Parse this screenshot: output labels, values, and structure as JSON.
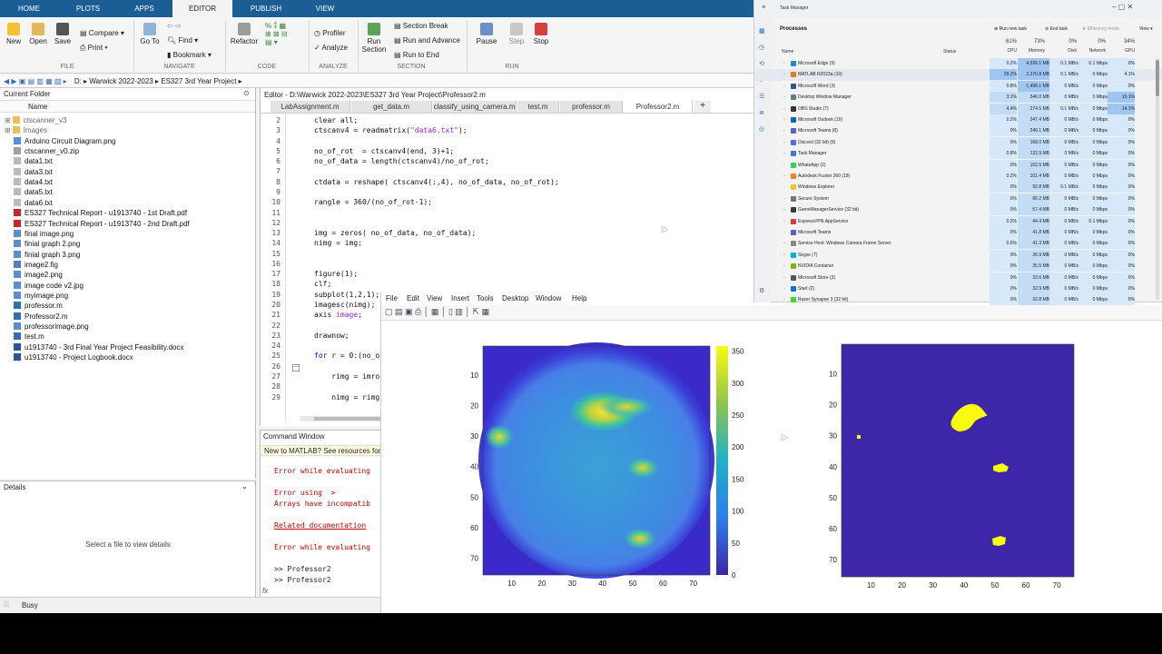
{
  "tabs": {
    "home": "HOME",
    "plots": "PLOTS",
    "apps": "APPS",
    "editor": "EDITOR",
    "publish": "PUBLISH",
    "view": "VIEW"
  },
  "ribbon": {
    "new": "New",
    "open": "Open",
    "save": "Save",
    "compare": "Compare",
    "print": "Print",
    "goto": "Go To",
    "find": "Find",
    "bookmark": "Bookmark",
    "refactor": "Refactor",
    "profiler": "Profiler",
    "analyze": "Analyze",
    "run_section": "Run Section",
    "section_break": "Section Break",
    "run_and_advance": "Run and Advance",
    "run_to_end": "Run to End",
    "pause": "Pause",
    "step": "Step",
    "stop": "Stop",
    "groups": {
      "file": "FILE",
      "navigate": "NAVIGATE",
      "code": "CODE",
      "analyze": "ANALYZE",
      "section": "SECTION",
      "run": "RUN"
    }
  },
  "address": {
    "root": "D:",
    "p1": "Warwick 2022-2023",
    "p2": "ES327 3rd Year Project"
  },
  "current_folder": {
    "title": "Current Folder",
    "name_col": "Name",
    "items": [
      {
        "label": "ctscanner_v3",
        "type": "folder"
      },
      {
        "label": "Images",
        "type": "folder"
      },
      {
        "label": "Arduino Circuit Diagram.png",
        "type": "png"
      },
      {
        "label": "ctscanner_v0.zip",
        "type": "zip"
      },
      {
        "label": "data1.txt",
        "type": "txt"
      },
      {
        "label": "data3.txt",
        "type": "txt"
      },
      {
        "label": "data4.txt",
        "type": "txt"
      },
      {
        "label": "data5.txt",
        "type": "txt"
      },
      {
        "label": "data6.txt",
        "type": "txt"
      },
      {
        "label": "ES327 Technical Report - u1913740 - 1st Draft.pdf",
        "type": "pdf"
      },
      {
        "label": "ES327 Technical Report - u1913740 - 2nd Draft.pdf",
        "type": "pdf"
      },
      {
        "label": "final image.png",
        "type": "png"
      },
      {
        "label": "finial graph 2.png",
        "type": "png"
      },
      {
        "label": "finial graph 3.png",
        "type": "png"
      },
      {
        "label": "image2.fig",
        "type": "fig"
      },
      {
        "label": "image2.png",
        "type": "png"
      },
      {
        "label": "image code v2.jpg",
        "type": "png"
      },
      {
        "label": "myimage.png",
        "type": "png"
      },
      {
        "label": "professor.m",
        "type": "m"
      },
      {
        "label": "Professor2.m",
        "type": "m"
      },
      {
        "label": "professorimage.png",
        "type": "png"
      },
      {
        "label": "test.m",
        "type": "m"
      },
      {
        "label": "u1913740 - 3rd Final Year Project Feasibility.docx",
        "type": "docx"
      },
      {
        "label": "u1913740 - Project Logbook.docx",
        "type": "docx"
      }
    ]
  },
  "details": {
    "title": "Details",
    "empty_msg": "Select a file to view details"
  },
  "editor": {
    "title": "Editor - D:\\Warwick 2022-2023\\ES327 3rd Year Project\\Professor2.m",
    "tabs": [
      "LabAssignment.m",
      "get_data.m",
      "classify_using_camera.m",
      "test.m",
      "professor.m",
      "Professor2.m"
    ],
    "lines": [
      {
        "n": "2",
        "t": "clear all;"
      },
      {
        "n": "3",
        "t": "ctscanv4 = readmatrix(",
        "s": "\"data6.txt\"",
        "e": ");"
      },
      {
        "n": "4",
        "t": ""
      },
      {
        "n": "5",
        "t": "no_of_rot  = ctscanv4(end, 3)+1;"
      },
      {
        "n": "6",
        "t": "no_of_data = length(ctscanv4)/no_of_rot;"
      },
      {
        "n": "7",
        "t": ""
      },
      {
        "n": "8",
        "t": "ctdata = reshape( ctscanv4(:,4), no_of_data, no_of_rot);"
      },
      {
        "n": "9",
        "t": ""
      },
      {
        "n": "10",
        "t": "rangle = 360/(no_of_rot-1);"
      },
      {
        "n": "11",
        "t": ""
      },
      {
        "n": "12",
        "t": ""
      },
      {
        "n": "13",
        "t": "img = zeros( no_of_data, no_of_data);"
      },
      {
        "n": "14",
        "t": "nimg = img;"
      },
      {
        "n": "15",
        "t": ""
      },
      {
        "n": "16",
        "t": ""
      },
      {
        "n": "17",
        "t": "figure(1);"
      },
      {
        "n": "18",
        "t": "clf;"
      },
      {
        "n": "19",
        "t": "subplot(1,2,1);"
      },
      {
        "n": "20",
        "t": "imagesc(nimg);"
      },
      {
        "n": "21",
        "t": "axis ",
        "s": "image",
        "e": ";"
      },
      {
        "n": "22",
        "t": ""
      },
      {
        "n": "23",
        "t": "drawnow;"
      },
      {
        "n": "24",
        "t": ""
      },
      {
        "n": "25",
        "k": "for",
        "t": " r = 0:(no_o"
      },
      {
        "n": "26",
        "t": ""
      },
      {
        "n": "27",
        "t": "    rimg = imro"
      },
      {
        "n": "28",
        "t": ""
      },
      {
        "n": "29",
        "t": "    nimg = rimg"
      }
    ]
  },
  "command_window": {
    "title": "Command Window",
    "banner": "New to MATLAB? See resources for G",
    "lines": [
      "Error while evaluating",
      "",
      "Error using  >",
      "Arrays have incompatib",
      "",
      "Related documentation",
      "",
      "Error while evaluating",
      "",
      ">> Professor2",
      ">> Professor2"
    ],
    "prompt": "fx"
  },
  "status": {
    "busy": "Busy"
  },
  "figure": {
    "menu": [
      "File",
      "Edit",
      "View",
      "Insert",
      "Tools",
      "Desktop",
      "Window",
      "Help"
    ],
    "left_axis_ticks_y": [
      "10",
      "20",
      "30",
      "40",
      "50",
      "60",
      "70"
    ],
    "left_axis_ticks_x": [
      "10",
      "20",
      "30",
      "40",
      "50",
      "60",
      "70"
    ],
    "colorbar_ticks": [
      "350",
      "300",
      "250",
      "200",
      "150",
      "100",
      "50",
      "0"
    ],
    "right_axis_ticks_y": [
      "10",
      "20",
      "30",
      "40",
      "50",
      "60",
      "70"
    ],
    "right_axis_ticks_x": [
      "10",
      "20",
      "30",
      "40",
      "50",
      "60",
      "70"
    ]
  },
  "taskmgr": {
    "title": "Task Manager",
    "toolbar": {
      "run_new": "Run new task",
      "end_task": "End task",
      "efficiency": "Efficiency mode",
      "view": "View"
    },
    "heading": "Processes",
    "cols": {
      "name": "Name",
      "status": "Status",
      "cpu": "CPU",
      "memory": "Memory",
      "disk": "Disk",
      "network": "Network",
      "gpu": "GPU"
    },
    "totals": {
      "cpu": "61%",
      "memory": "73%",
      "disk": "0%",
      "network": "0%",
      "gpu": "34%"
    },
    "rows": [
      {
        "name": "Microsoft Edge (9)",
        "cpu": "0.2%",
        "mem": "4,026.1 MB",
        "disk": "0.1 MB/s",
        "net": "0.1 Mbps",
        "gpu": "0%"
      },
      {
        "name": "MATLAB R2023a (10)",
        "cpu": "29.2%",
        "mem": "2,270.8 MB",
        "disk": "0.1 MB/s",
        "net": "0 Mbps",
        "gpu": "4.1%"
      },
      {
        "name": "Microsoft Word (3)",
        "cpu": "0.8%",
        "mem": "1,498.1 MB",
        "disk": "0 MB/s",
        "net": "0 Mbps",
        "gpu": "0%"
      },
      {
        "name": "Desktop Window Manager",
        "cpu": "3.1%",
        "mem": "346.0 MB",
        "disk": "0 MB/s",
        "net": "0 Mbps",
        "gpu": "10.1%"
      },
      {
        "name": "OBS Studio (7)",
        "cpu": "4.4%",
        "mem": "274.5 MB",
        "disk": "0.1 MB/s",
        "net": "0 Mbps",
        "gpu": "14.1%"
      },
      {
        "name": "Microsoft Outlook (10)",
        "cpu": "0.2%",
        "mem": "247.4 MB",
        "disk": "0 MB/s",
        "net": "0 Mbps",
        "gpu": "0%"
      },
      {
        "name": "Microsoft Teams (8)",
        "cpu": "0%",
        "mem": "240.1 MB",
        "disk": "0 MB/s",
        "net": "0 Mbps",
        "gpu": "0%"
      },
      {
        "name": "Discord (32 bit) (8)",
        "cpu": "0%",
        "mem": "168.0 MB",
        "disk": "0 MB/s",
        "net": "0 Mbps",
        "gpu": "0%"
      },
      {
        "name": "Task Manager",
        "cpu": "0.8%",
        "mem": "132.9 MB",
        "disk": "0 MB/s",
        "net": "0 Mbps",
        "gpu": "0%"
      },
      {
        "name": "WhatsApp (2)",
        "cpu": "0%",
        "mem": "102.5 MB",
        "disk": "0 MB/s",
        "net": "0 Mbps",
        "gpu": "0%"
      },
      {
        "name": "Autodesk Fusion 360 (18)",
        "cpu": "0.2%",
        "mem": "101.4 MB",
        "disk": "0 MB/s",
        "net": "0 Mbps",
        "gpu": "0%"
      },
      {
        "name": "Windows Explorer",
        "cpu": "0%",
        "mem": "92.8 MB",
        "disk": "0.1 MB/s",
        "net": "0 Mbps",
        "gpu": "0%"
      },
      {
        "name": "Secure System",
        "cpu": "0%",
        "mem": "80.2 MB",
        "disk": "0 MB/s",
        "net": "0 Mbps",
        "gpu": "0%"
      },
      {
        "name": "GameManagerService (32 bit)",
        "cpu": "0%",
        "mem": "57.4 MB",
        "disk": "0 MB/s",
        "net": "0 Mbps",
        "gpu": "0%"
      },
      {
        "name": "ExpressVPN.AppService",
        "cpu": "0.2%",
        "mem": "44.4 MB",
        "disk": "0 MB/s",
        "net": "0.1 Mbps",
        "gpu": "0%"
      },
      {
        "name": "Microsoft Teams",
        "cpu": "0%",
        "mem": "41.8 MB",
        "disk": "0 MB/s",
        "net": "0 Mbps",
        "gpu": "0%"
      },
      {
        "name": "Service Host: Windows Camera Frame Server",
        "cpu": "0.6%",
        "mem": "41.3 MB",
        "disk": "0 MB/s",
        "net": "0 Mbps",
        "gpu": "0%"
      },
      {
        "name": "Skype (7)",
        "cpu": "0%",
        "mem": "36.9 MB",
        "disk": "0 MB/s",
        "net": "0 Mbps",
        "gpu": "0%"
      },
      {
        "name": "NVIDIA Container",
        "cpu": "0%",
        "mem": "35.5 MB",
        "disk": "0 MB/s",
        "net": "0 Mbps",
        "gpu": "0%"
      },
      {
        "name": "Microsoft Store (3)",
        "cpu": "0%",
        "mem": "33.6 MB",
        "disk": "0 MB/s",
        "net": "0 Mbps",
        "gpu": "0%"
      },
      {
        "name": "Start (2)",
        "cpu": "0%",
        "mem": "32.9 MB",
        "disk": "0 MB/s",
        "net": "0 Mbps",
        "gpu": "0%"
      },
      {
        "name": "Razer Synapse 3 (32 bit)",
        "cpu": "0%",
        "mem": "32.8 MB",
        "disk": "0 MB/s",
        "net": "0 Mbps",
        "gpu": "0%"
      }
    ]
  }
}
